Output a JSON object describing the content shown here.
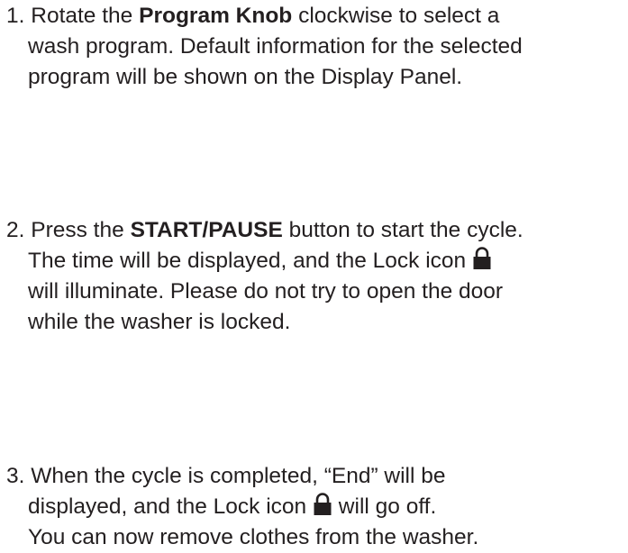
{
  "steps": [
    {
      "number": "1.",
      "lines": [
        [
          "Rotate the ",
          "Program Knob",
          " clockwise to select a"
        ],
        "wash program. Default information for the selected",
        "program will be shown on the Display Panel."
      ]
    },
    {
      "number": "2.",
      "lines": [
        [
          "Press the ",
          "START/PAUSE",
          " button to start the cycle."
        ],
        [
          "The time will be displayed, and the Lock icon",
          ""
        ],
        "will illuminate. Please do not try to open the door",
        "while the washer is locked."
      ]
    },
    {
      "number": "3.",
      "lines": [
        "When the cycle is completed, “End” will be",
        [
          "displayed, and the Lock icon",
          " will go off."
        ],
        "You can now remove clothes from the washer."
      ]
    }
  ],
  "icons": {
    "lock": "lock-icon",
    "color": "#231f20"
  }
}
